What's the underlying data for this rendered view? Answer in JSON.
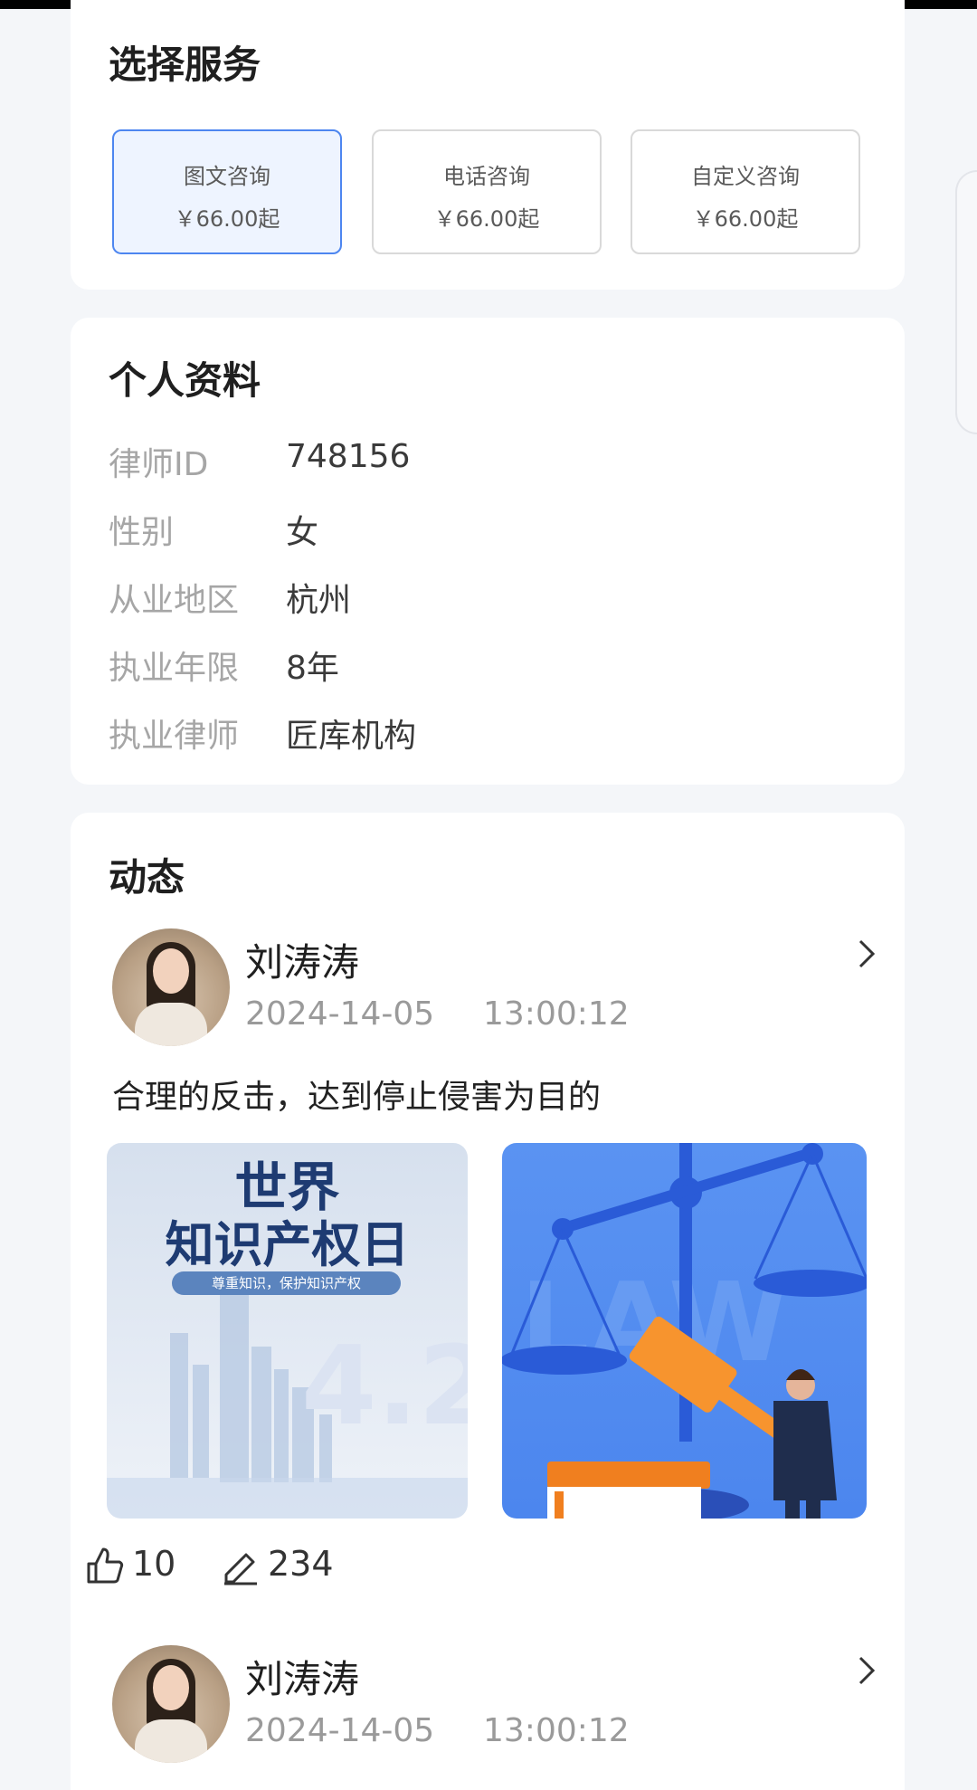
{
  "services": {
    "title": "选择服务",
    "options": [
      {
        "name": "图文咨询",
        "price": "￥66.00起",
        "selected": true
      },
      {
        "name": "电话咨询",
        "price": "￥66.00起",
        "selected": false
      },
      {
        "name": "自定义咨询",
        "price": "￥66.00起",
        "selected": false
      }
    ]
  },
  "profile": {
    "title": "个人资料",
    "rows": [
      {
        "key": "律师ID",
        "value": "748156"
      },
      {
        "key": "性别",
        "value": "女"
      },
      {
        "key": "从业地区",
        "value": "杭州"
      },
      {
        "key": "执业年限",
        "value": "8年"
      },
      {
        "key": "执业律师",
        "value": "匠库机构"
      }
    ]
  },
  "feed": {
    "title": "动态",
    "posts": [
      {
        "author": "刘涛涛",
        "date": "2024-14-05",
        "time": "13:00:12",
        "text": "合理的反击，达到停止侵害为目的",
        "image1": {
          "title_line1": "世界",
          "title_line2": "知识产权日",
          "subtitle": "尊重知识，保护知识产权"
        },
        "likes": "10",
        "comments": "234"
      },
      {
        "author": "刘涛涛",
        "date": "2024-14-05",
        "time": "13:00:12"
      }
    ]
  },
  "colors": {
    "accent": "#4d86f0",
    "selected_bg": "#eef4ff",
    "page_bg": "#f4f6f9"
  }
}
